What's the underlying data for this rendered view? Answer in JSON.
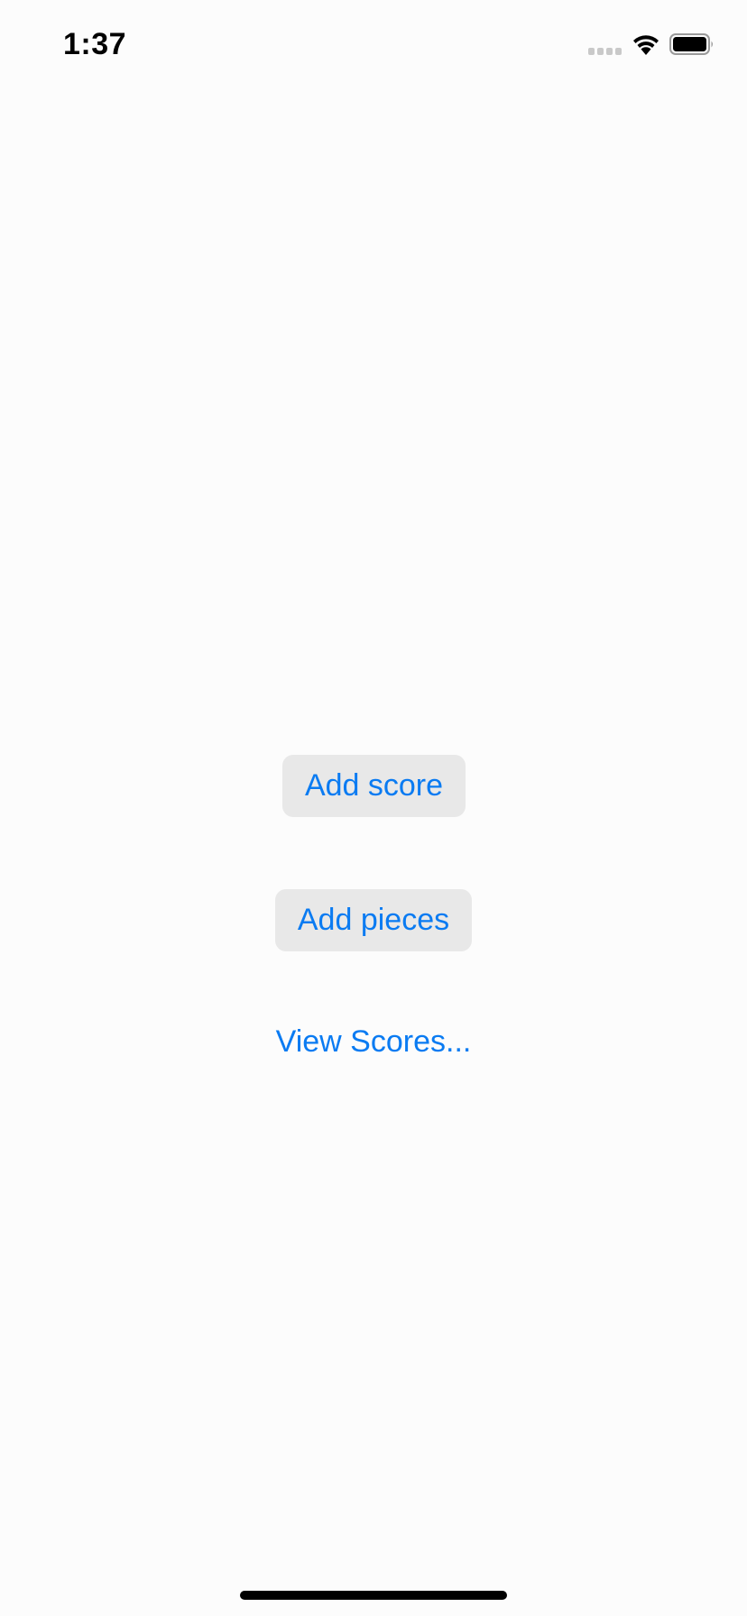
{
  "status_bar": {
    "time": "1:37",
    "signal_icon": "cellular-signal-icon",
    "wifi_icon": "wifi-icon",
    "battery_icon": "battery-icon"
  },
  "main": {
    "add_score_label": "Add score",
    "add_pieces_label": "Add pieces",
    "view_scores_label": "View Scores..."
  },
  "colors": {
    "accent": "#0a7bf2",
    "button_bg": "#e8e8e8",
    "background": "#fcfcfc"
  }
}
